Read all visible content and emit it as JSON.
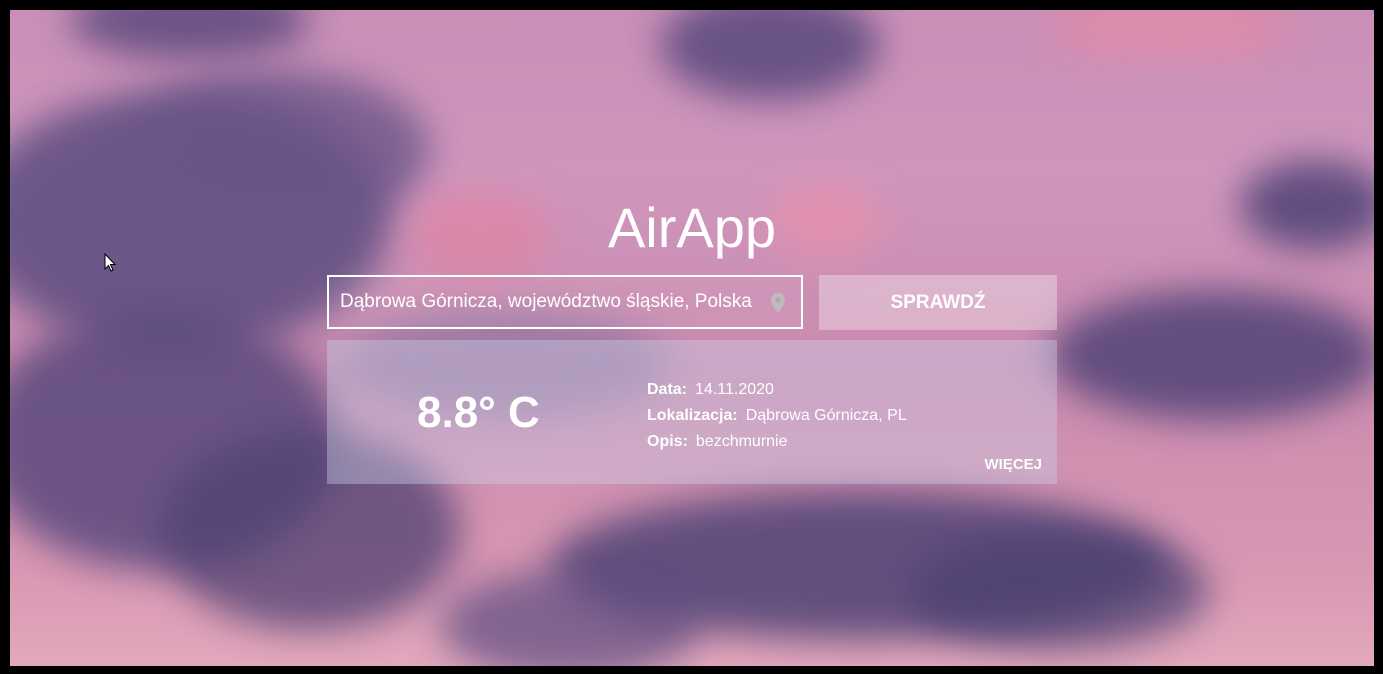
{
  "app": {
    "title": "AirApp"
  },
  "search": {
    "value": "Dąbrowa Górnicza, województwo śląskie, Polska",
    "icon": "location-pin-icon"
  },
  "check_button": {
    "label": "SPRAWDŹ"
  },
  "weather": {
    "temperature": "8.8° C",
    "date_label": "Data:",
    "date_value": "14.11.2020",
    "location_label": "Lokalizacja:",
    "location_value": "Dąbrowa Górnicza, PL",
    "description_label": "Opis:",
    "description_value": "bezchmurnie",
    "more_label": "WIĘCEJ"
  },
  "colors": {
    "text": "#ffffff",
    "background_sky": "#c98fb6",
    "cloud_dark": "#5a4a7e"
  }
}
